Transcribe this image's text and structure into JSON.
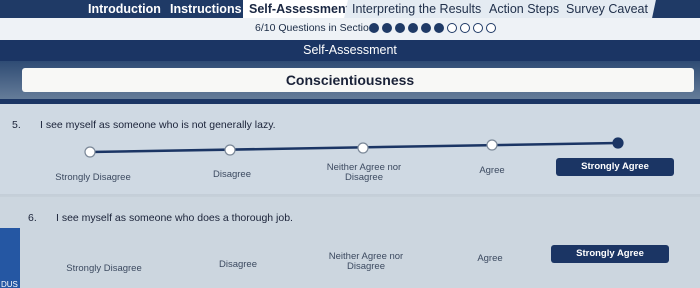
{
  "tabs": [
    {
      "label": "Introduction"
    },
    {
      "label": "Instructions"
    },
    {
      "label": "Self-Assessment"
    },
    {
      "label": "Interpreting the Results"
    },
    {
      "label": "Action Steps"
    },
    {
      "label": "Survey Caveat"
    }
  ],
  "progress": {
    "text": "6/10 Questions in Section",
    "answered": 6,
    "total": 10
  },
  "section": {
    "title": "Self-Assessment",
    "category": "Conscientiousness"
  },
  "scale_options": [
    "Strongly Disagree",
    "Disagree",
    "Neither Agree nor Disagree",
    "Agree",
    "Strongly Agree"
  ],
  "scale_labels": {
    "strongly_disagree": "Strongly Disagree",
    "disagree": "Disagree",
    "neutral_line1": "Neither Agree nor",
    "neutral_line2": "Disagree",
    "agree": "Agree",
    "strongly_agree": "Strongly Agree"
  },
  "questions": [
    {
      "number": "5.",
      "text": "I see myself as someone who is not generally lazy.",
      "selected": "Strongly Agree"
    },
    {
      "number": "6.",
      "text": "I see myself as someone who does a thorough job.",
      "selected": "Strongly Agree"
    }
  ],
  "left_edge_text": "DUS",
  "colors": {
    "navy": "#1b3564",
    "tab_bar": "#1f3a66",
    "card": "#cfd9e3",
    "accent_blue": "#2557a3"
  }
}
